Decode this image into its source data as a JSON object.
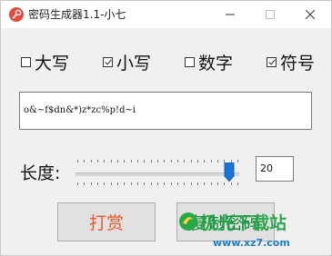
{
  "window": {
    "title": "密码生成器1.1-小七"
  },
  "options": [
    {
      "label": "大写",
      "checked": false
    },
    {
      "label": "小写",
      "checked": true
    },
    {
      "label": "数字",
      "checked": false
    },
    {
      "label": "符号",
      "checked": true
    }
  ],
  "output": {
    "value": "o&~f$dn&*)z*zc%p!d~i"
  },
  "length": {
    "label": "长度:",
    "value": "20",
    "slider_fraction": 0.95
  },
  "buttons": {
    "donate": "打赏",
    "copy": "复制密码"
  },
  "watermark": {
    "text": "极光下载站",
    "url": "www.xz7.com"
  },
  "colors": {
    "donate": "#e8562a",
    "copy": "#0e8a3a",
    "slider_thumb": "#1a73d9"
  }
}
